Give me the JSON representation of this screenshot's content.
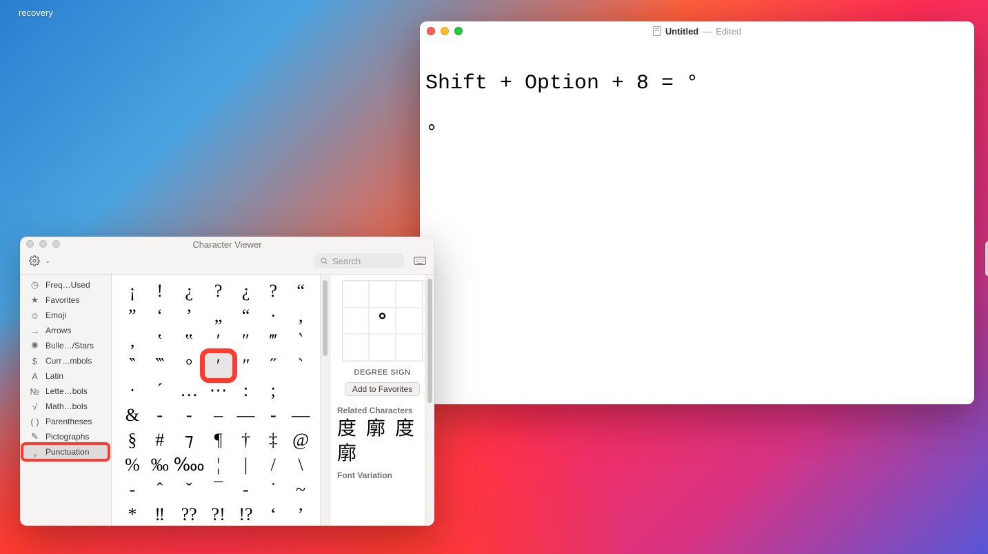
{
  "desktop": {
    "folder_label": "recovery"
  },
  "textedit": {
    "title": "Untitled",
    "state": "Edited",
    "content": "Shift + Option + 8 = °\n\n°"
  },
  "character_viewer": {
    "title": "Character Viewer",
    "search_placeholder": "Search",
    "sidebar": [
      {
        "id": "frequently-used",
        "icon": "clock",
        "label": "Freq…Used"
      },
      {
        "id": "favorites",
        "icon": "star",
        "label": "Favorites"
      },
      {
        "id": "emoji",
        "icon": "smile",
        "label": "Emoji"
      },
      {
        "id": "arrows",
        "icon": "arrow",
        "label": "Arrows"
      },
      {
        "id": "bullets-stars",
        "icon": "spark",
        "label": "Bulle…/Stars"
      },
      {
        "id": "currency",
        "icon": "dollar",
        "label": "Curr…mbols"
      },
      {
        "id": "latin",
        "icon": "A",
        "label": "Latin"
      },
      {
        "id": "letterlike",
        "icon": "No",
        "label": "Lette…bols"
      },
      {
        "id": "math",
        "icon": "root",
        "label": "Math…bols"
      },
      {
        "id": "parentheses",
        "icon": "parens",
        "label": "Parentheses"
      },
      {
        "id": "pictographs",
        "icon": "pencil",
        "label": "Pictographs"
      },
      {
        "id": "punctuation",
        "icon": "dots",
        "label": "Punctuation",
        "selected": true,
        "highlighted": true
      }
    ],
    "grid": [
      "¡",
      "!",
      "¿",
      "?",
      "¿",
      "?",
      "“",
      "”",
      "‘",
      "’",
      "„",
      "“",
      "·",
      "‚",
      "‚",
      "‛",
      "‟",
      "′",
      "″",
      "‴",
      "‵",
      "‶",
      "‷",
      "°",
      "ʹ",
      "ʺ",
      "˝",
      "`",
      "·",
      "´",
      "…",
      "⋯",
      ":",
      ";",
      "",
      "&",
      "-",
      "‐",
      "–",
      "—",
      "‑",
      "—",
      "§",
      "#",
      "⁊",
      "¶",
      "†",
      "‡",
      "@",
      "%",
      "‰",
      "‱",
      "¦",
      "|",
      "/",
      "\\",
      "-",
      "ˆ",
      "ˇ",
      "¯",
      "-",
      "˙",
      "~",
      "*",
      "‼",
      "??",
      "?!",
      "!?",
      "‘",
      "’"
    ],
    "selected_index": 24,
    "highlighted_index": 24,
    "detail": {
      "glyph": "°",
      "name": "DEGREE SIGN",
      "favorite_button": "Add to Favorites",
      "related_label": "Related Characters",
      "related": [
        "度",
        "廓",
        "度",
        "廓"
      ],
      "font_variation_label": "Font Variation"
    }
  }
}
